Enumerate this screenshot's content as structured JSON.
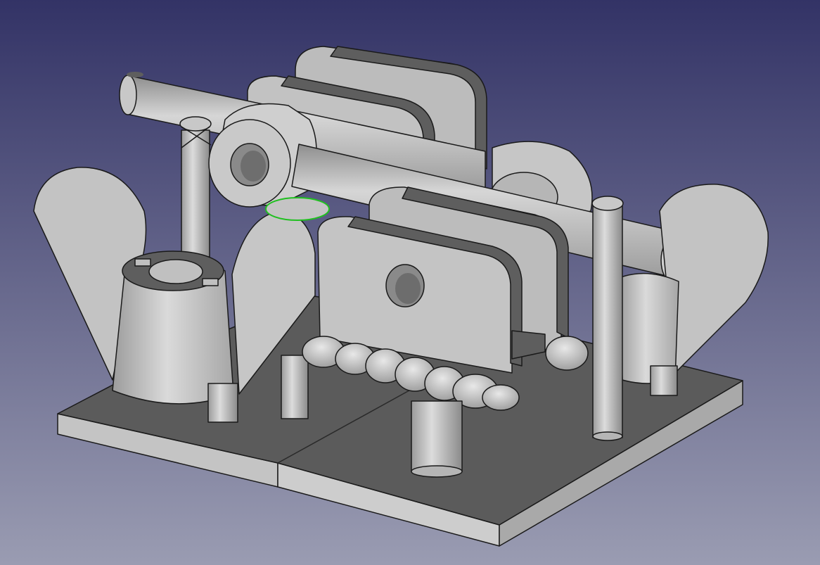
{
  "app": {
    "view": "3d-viewport",
    "background": {
      "top_color": "#333366",
      "bottom_color": "#9a9cb2"
    },
    "model": {
      "description_icon": "cad-assembly-model",
      "body_color": "#bfbfbf",
      "edge_color": "#1a1a1a",
      "base_top_color": "#5b5b5b",
      "preselection_highlight_color": "#20c020"
    }
  }
}
